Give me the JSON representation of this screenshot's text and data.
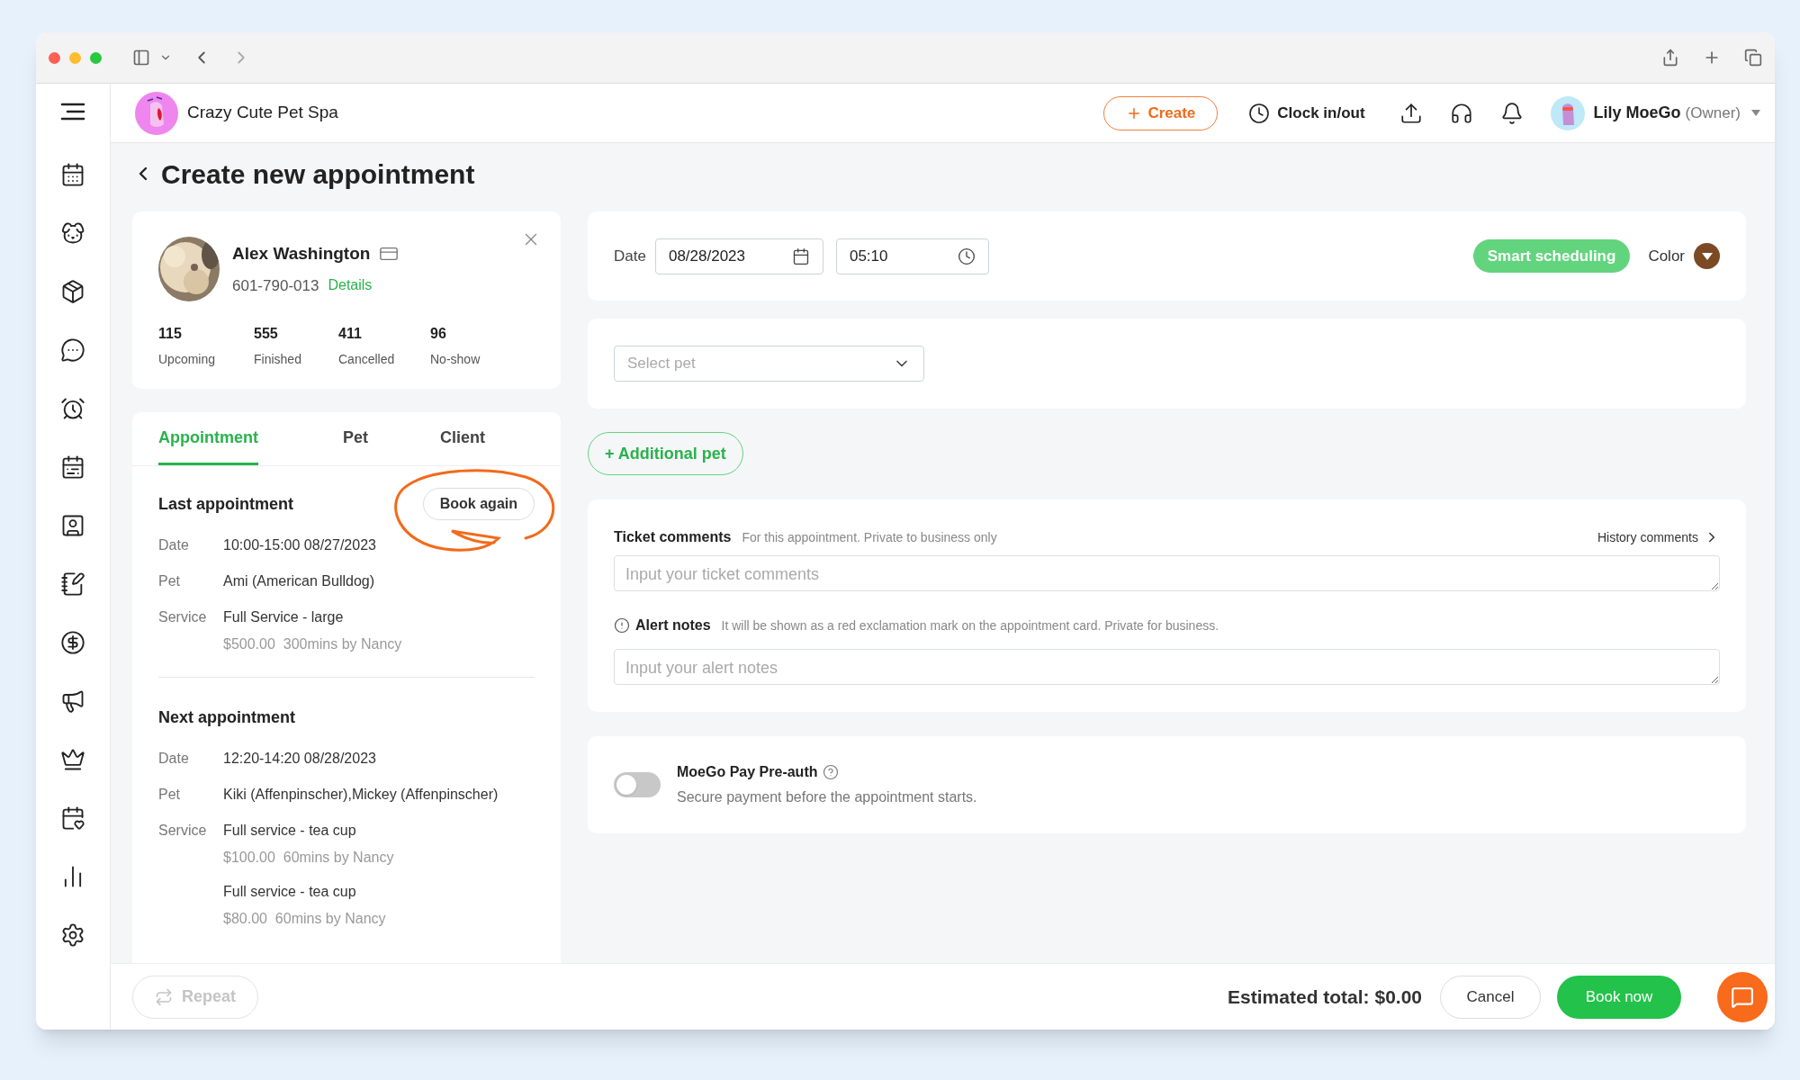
{
  "header": {
    "business_name": "Crazy Cute Pet Spa",
    "create_button": "Create",
    "clock_button": "Clock in/out",
    "user": {
      "name": "Lily MoeGo",
      "role": "(Owner)"
    }
  },
  "page_title": "Create new appointment",
  "client": {
    "name": "Alex Washington",
    "phone": "601-790-013",
    "details_link": "Details",
    "stats": [
      {
        "value": "115",
        "label": "Upcoming"
      },
      {
        "value": "555",
        "label": "Finished"
      },
      {
        "value": "411",
        "label": "Cancelled"
      },
      {
        "value": "96",
        "label": "No-show"
      }
    ]
  },
  "tabs": [
    {
      "label": "Appointment",
      "selected": true
    },
    {
      "label": "Pet",
      "selected": false
    },
    {
      "label": "Client",
      "selected": false
    }
  ],
  "last_appointment": {
    "title": "Last appointment",
    "action": "Book again",
    "rows": [
      {
        "label": "Date",
        "value": "10:00-15:00 08/27/2023"
      },
      {
        "label": "Pet",
        "value": "Ami (American Bulldog)"
      },
      {
        "label": "Service",
        "items": [
          {
            "name": "Full Service - large",
            "detail": "$500.00  300mins by Nancy"
          }
        ]
      }
    ]
  },
  "next_appointment": {
    "title": "Next appointment",
    "rows": [
      {
        "label": "Date",
        "value": "12:20-14:20 08/28/2023"
      },
      {
        "label": "Pet",
        "value": "Kiki (Affenpinscher),Mickey (Affenpinscher)"
      },
      {
        "label": "Service",
        "items": [
          {
            "name": "Full service - tea cup",
            "detail": "$100.00  60mins by Nancy"
          },
          {
            "name": "Full service - tea cup",
            "detail": "$80.00  60mins by Nancy"
          }
        ]
      }
    ]
  },
  "schedule": {
    "date_label": "Date",
    "date": "08/28/2023",
    "time": "05:10",
    "smart_button": "Smart scheduling",
    "color_label": "Color",
    "color": "#7b4a24"
  },
  "pet_select": {
    "placeholder": "Select pet"
  },
  "additional_pet_button": "+ Additional pet",
  "ticket_comments": {
    "label": "Ticket comments",
    "hint": "For this appointment. Private to business only",
    "history_link": "History comments",
    "placeholder": "Input your ticket comments"
  },
  "alert_notes": {
    "label": "Alert notes",
    "hint": "It will be shown as a red exclamation mark on the appointment card. Private for business.",
    "placeholder": "Input your alert notes"
  },
  "preauth": {
    "on": false,
    "title": "MoeGo Pay Pre-auth",
    "description": "Secure payment before the appointment starts."
  },
  "footer": {
    "repeat_button": "Repeat",
    "total": "Estimated total: $0.00",
    "cancel_button": "Cancel",
    "book_button": "Book now"
  }
}
